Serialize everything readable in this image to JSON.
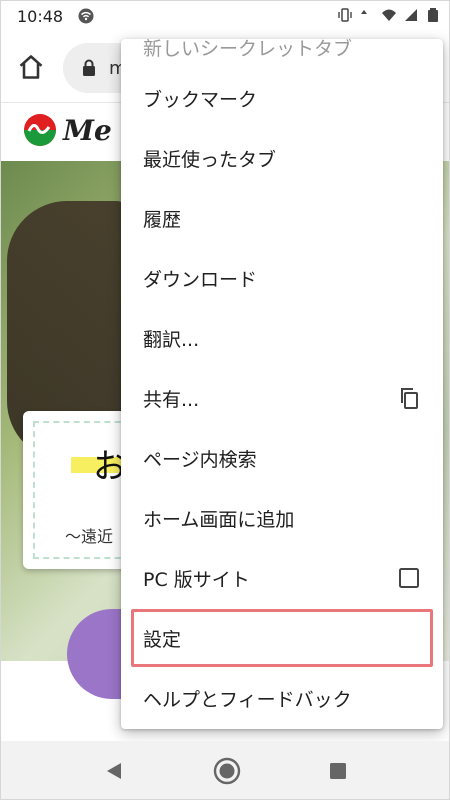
{
  "status_bar": {
    "time": "10:48",
    "icons": [
      "wifi-icon",
      "vibrate-icon",
      "data-arrows-icon",
      "wifi-signal-icon",
      "cell-signal-icon",
      "battery-icon"
    ]
  },
  "toolbar": {
    "url_text": "m",
    "icons": [
      "home-icon",
      "lock-icon"
    ]
  },
  "page": {
    "logo_text": "Me",
    "card_big_text": "お",
    "card_small_text": "〜遠近"
  },
  "menu": {
    "items": [
      {
        "label": "新しいシークレットタブ"
      },
      {
        "label": "ブックマーク"
      },
      {
        "label": "最近使ったタブ"
      },
      {
        "label": "履歴"
      },
      {
        "label": "ダウンロード"
      },
      {
        "label": "翻訳..."
      },
      {
        "label": "共有...",
        "trailing_icon": "copy-icon"
      },
      {
        "label": "ページ内検索"
      },
      {
        "label": "ホーム画面に追加"
      },
      {
        "label": "PC 版サイト",
        "trailing_icon": "checkbox-icon",
        "checked": false
      },
      {
        "label": "設定",
        "highlighted": true
      },
      {
        "label": "ヘルプとフィードバック"
      }
    ]
  },
  "colors": {
    "highlight_border": "#e8767a",
    "purple_button": "#9b76c8",
    "logo_red": "#e02020",
    "logo_green": "#1a9a3a"
  },
  "navbar": {
    "icons": [
      "back-icon",
      "home-circle-icon",
      "recent-apps-icon"
    ]
  }
}
